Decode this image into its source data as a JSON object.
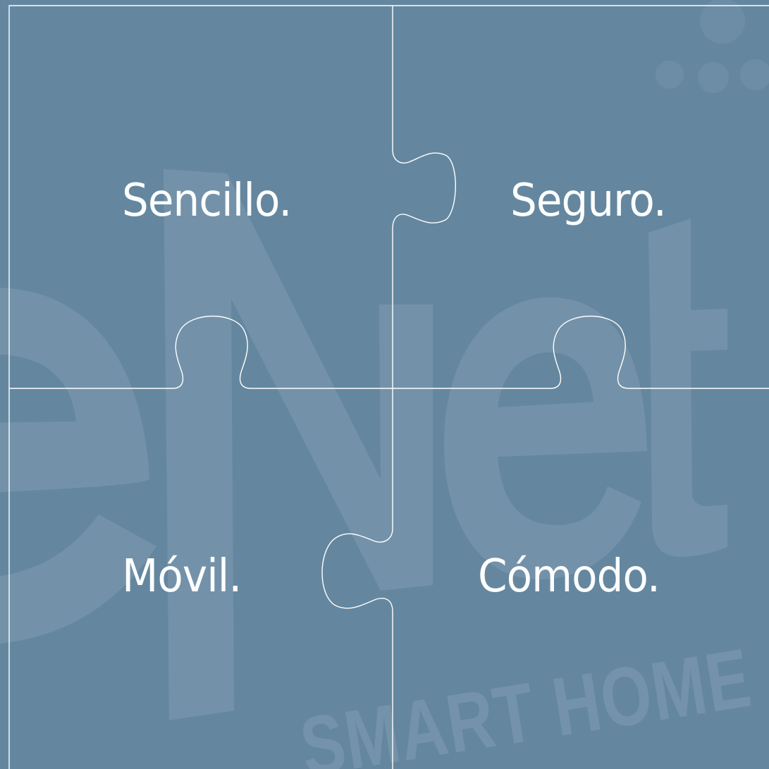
{
  "colors": {
    "background": "#64879f",
    "watermark": "#7896ad",
    "lines": "#ffffff",
    "text": "#ffffff"
  },
  "watermark": {
    "logo_text": "eNet",
    "tagline": "SMART HOME"
  },
  "tiles": [
    {
      "label": "Sencillo."
    },
    {
      "label": "Seguro."
    },
    {
      "label": "Móvil."
    },
    {
      "label": "Cómodo."
    }
  ]
}
